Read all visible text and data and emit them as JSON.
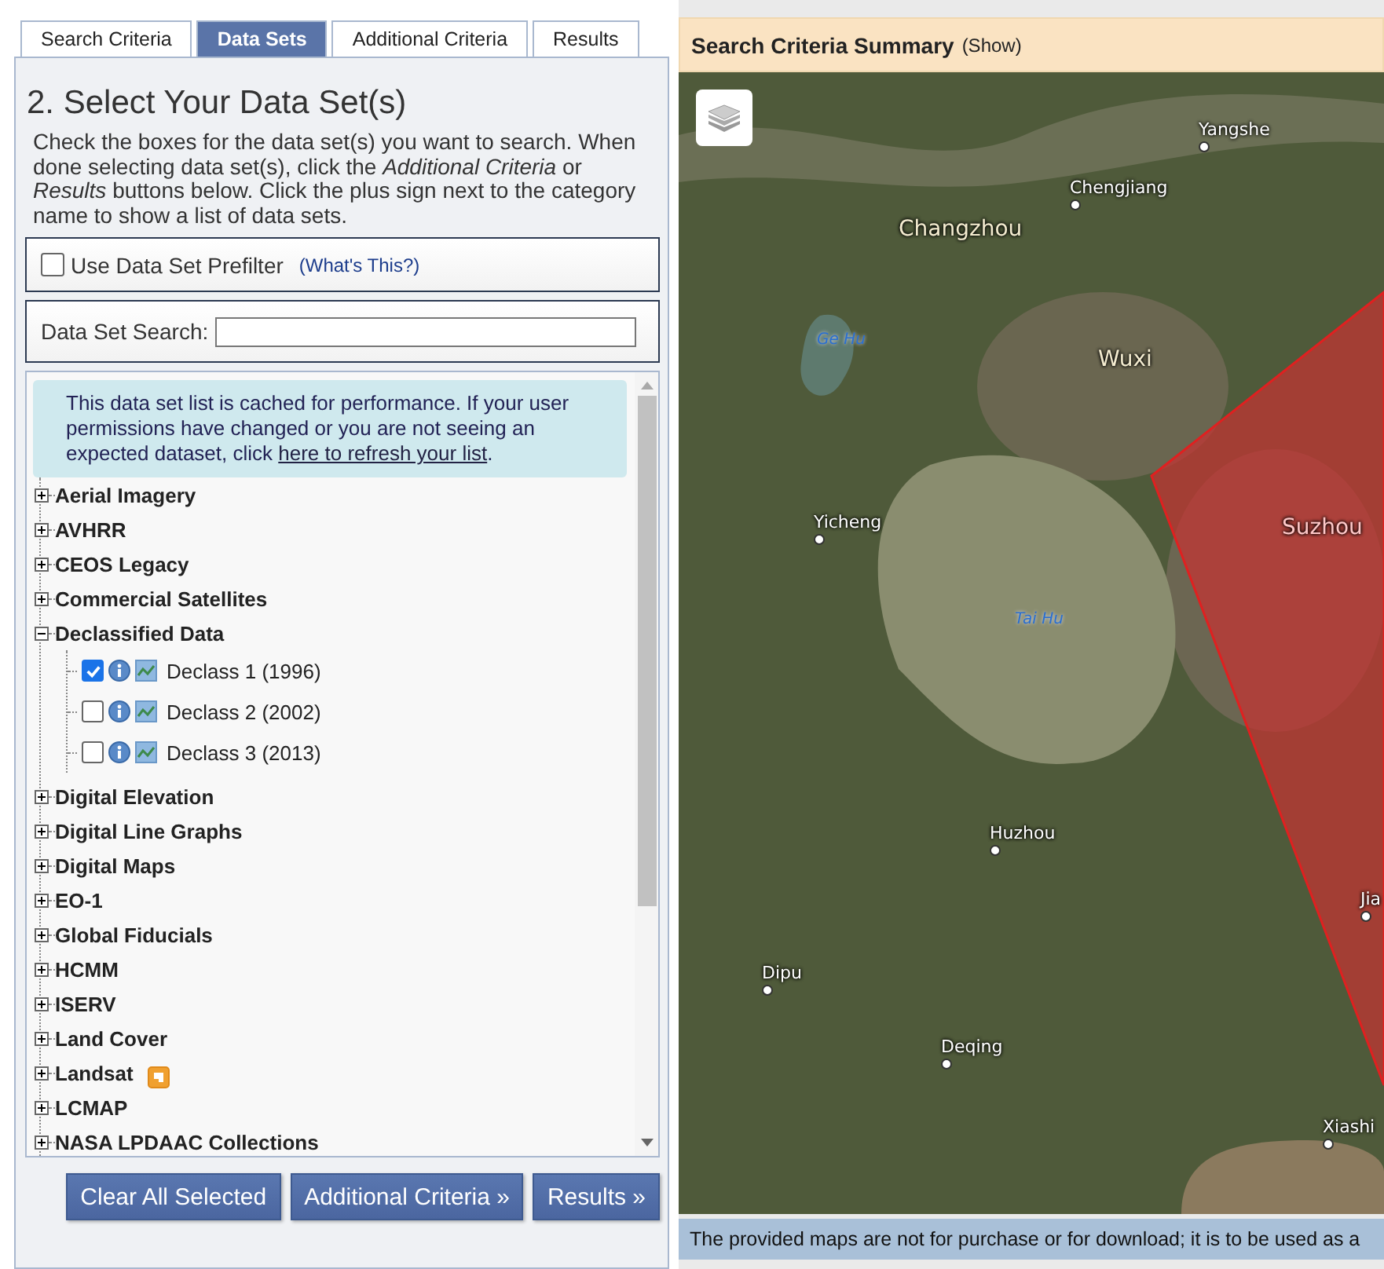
{
  "tabs": [
    {
      "label": "Search Criteria",
      "selected": false
    },
    {
      "label": "Data Sets",
      "selected": true
    },
    {
      "label": "Additional Criteria",
      "selected": false
    },
    {
      "label": "Results",
      "selected": false
    }
  ],
  "heading": "2. Select Your Data Set(s)",
  "instructions": "Check the boxes for the data set(s) you want to search. When done selecting data set(s), click the *Additional Criteria* or *Results* buttons below. Click the plus sign next to the category name to show a list of data sets.",
  "prefilter": {
    "label": "Use Data Set Prefilter",
    "checked": false,
    "help_link": "(What's This?)"
  },
  "search": {
    "label": "Data Set Search:"
  },
  "notice": {
    "text": "This data set list is cached for performance. If your user permissions have changed or you are not seeing an expected dataset, click ",
    "link": "here to refresh your list",
    "end": "."
  },
  "categories": [
    {
      "label": "Aerial Imagery",
      "expanded": false,
      "flagged": false
    },
    {
      "label": "AVHRR",
      "expanded": false,
      "flagged": false
    },
    {
      "label": "CEOS Legacy",
      "expanded": false,
      "flagged": false
    },
    {
      "label": "Commercial Satellites",
      "expanded": false,
      "flagged": false
    },
    {
      "label": "Declassified Data",
      "expanded": true,
      "flagged": false,
      "children": [
        {
          "label": "Declass 1 (1996)",
          "checked": true
        },
        {
          "label": "Declass 2 (2002)",
          "checked": false
        },
        {
          "label": "Declass 3 (2013)",
          "checked": false
        }
      ]
    },
    {
      "label": "Digital Elevation",
      "expanded": false,
      "flagged": false
    },
    {
      "label": "Digital Line Graphs",
      "expanded": false,
      "flagged": false
    },
    {
      "label": "Digital Maps",
      "expanded": false,
      "flagged": false
    },
    {
      "label": "EO-1",
      "expanded": false,
      "flagged": false
    },
    {
      "label": "Global Fiducials",
      "expanded": false,
      "flagged": false
    },
    {
      "label": "HCMM",
      "expanded": false,
      "flagged": false
    },
    {
      "label": "ISERV",
      "expanded": false,
      "flagged": false
    },
    {
      "label": "Land Cover",
      "expanded": false,
      "flagged": false
    },
    {
      "label": "Landsat",
      "expanded": false,
      "flagged": true
    },
    {
      "label": "LCMAP",
      "expanded": false,
      "flagged": false
    },
    {
      "label": "NASA LPDAAC Collections",
      "expanded": false,
      "flagged": false
    }
  ],
  "buttons": [
    "Clear All Selected",
    "Additional Criteria »",
    "Results »"
  ],
  "summary": {
    "title": "Search Criteria Summary",
    "toggle": "(Show)"
  },
  "map_labels": [
    {
      "name": "Yangshe",
      "kind": "town"
    },
    {
      "name": "Chengjiang",
      "kind": "town"
    },
    {
      "name": "Changzhou",
      "kind": "city"
    },
    {
      "name": "Ge Hu",
      "kind": "water"
    },
    {
      "name": "Wuxi",
      "kind": "city"
    },
    {
      "name": "Yicheng",
      "kind": "town"
    },
    {
      "name": "Suzhou",
      "kind": "area"
    },
    {
      "name": "Tai Hu",
      "kind": "water"
    },
    {
      "name": "Huzhou",
      "kind": "town"
    },
    {
      "name": "Jia",
      "kind": "town"
    },
    {
      "name": "Dipu",
      "kind": "town"
    },
    {
      "name": "Deqing",
      "kind": "town"
    },
    {
      "name": "Xiashi",
      "kind": "town"
    }
  ],
  "map_notice": "The provided maps are not for purchase or for download; it is to be used as a"
}
